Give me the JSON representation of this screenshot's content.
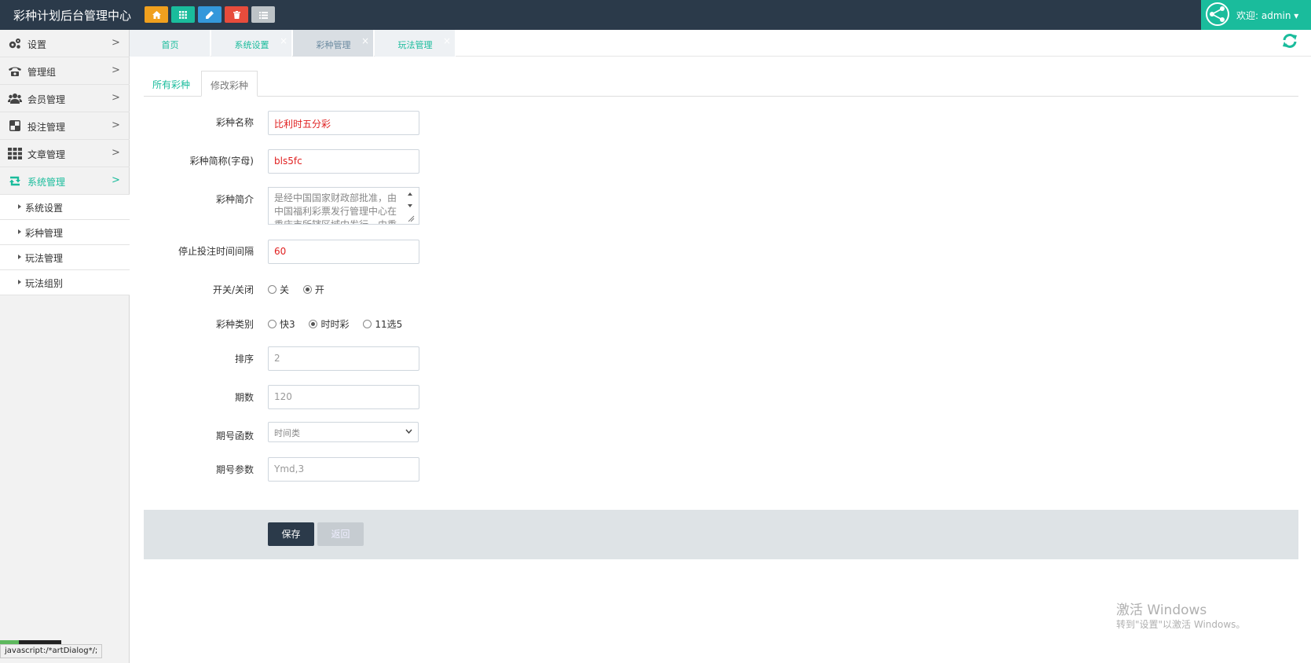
{
  "header": {
    "title": "彩种计划后台管理中心",
    "quick_buttons": [
      {
        "icon": "home-icon",
        "color": "#f0a01e"
      },
      {
        "icon": "grid-icon",
        "color": "#1abc9c"
      },
      {
        "icon": "pencil-icon",
        "color": "#3498db"
      },
      {
        "icon": "trash-icon",
        "color": "#e74c3c"
      },
      {
        "icon": "list-icon",
        "color": "#bdc3c7"
      }
    ],
    "welcome": "欢迎: admin ▾"
  },
  "sidebar": {
    "items": [
      {
        "label": "设置",
        "icon": "gears-icon"
      },
      {
        "label": "管理组",
        "icon": "phone-icon"
      },
      {
        "label": "会员管理",
        "icon": "users-icon"
      },
      {
        "label": "投注管理",
        "icon": "checkerboard-icon"
      },
      {
        "label": "文章管理",
        "icon": "grid-icon"
      },
      {
        "label": "系统管理",
        "icon": "retweet-icon",
        "active": true
      }
    ],
    "arrow": ">",
    "sub_items": [
      {
        "label": "系统设置"
      },
      {
        "label": "彩种管理"
      },
      {
        "label": "玩法管理"
      },
      {
        "label": "玩法组别"
      }
    ],
    "status_url": "javascript:/*artDialog*/;"
  },
  "tabs": [
    {
      "label": "首页",
      "closable": false
    },
    {
      "label": "系统设置",
      "closable": true
    },
    {
      "label": "彩种管理",
      "closable": true,
      "active": true
    },
    {
      "label": "玩法管理",
      "closable": true
    }
  ],
  "tab_close": "×",
  "subtabs": [
    {
      "label": "所有彩种"
    },
    {
      "label": "修改彩种",
      "active": true
    }
  ],
  "form": {
    "name_label": "彩种名称",
    "name_value": "比利时五分彩",
    "abbr_label": "彩种简称(字母)",
    "abbr_value": "bls5fc",
    "intro_label": "彩种简介",
    "intro_value": "是经中国国家财政部批准，由中国福利彩票发行管理中心在重庆市所辖区域内发行，由重庆市福利彩票发行中心承销",
    "stop_label": "停止投注时间间隔",
    "stop_value": "60",
    "switch_label": "开关/关闭",
    "switch_options": [
      {
        "label": "关",
        "checked": false
      },
      {
        "label": "开",
        "checked": true
      }
    ],
    "type_label": "彩种类别",
    "type_options": [
      {
        "label": "快3",
        "checked": false
      },
      {
        "label": "时时彩",
        "checked": true
      },
      {
        "label": "11选5",
        "checked": false
      }
    ],
    "sort_label": "排序",
    "sort_value": "2",
    "periods_label": "期数",
    "periods_value": "120",
    "func_label": "期号函数",
    "func_value": "时间类",
    "param_label": "期号参数",
    "param_value": "Ymd,3"
  },
  "buttons": {
    "save": "保存",
    "back": "返回"
  },
  "watermark": {
    "line1": "激活 Windows",
    "line2": "转到\"设置\"以激活 Windows。"
  },
  "colors": {
    "topbar": "#2b3a4a",
    "accent": "#1abc9c",
    "value_red": "#e02020"
  }
}
